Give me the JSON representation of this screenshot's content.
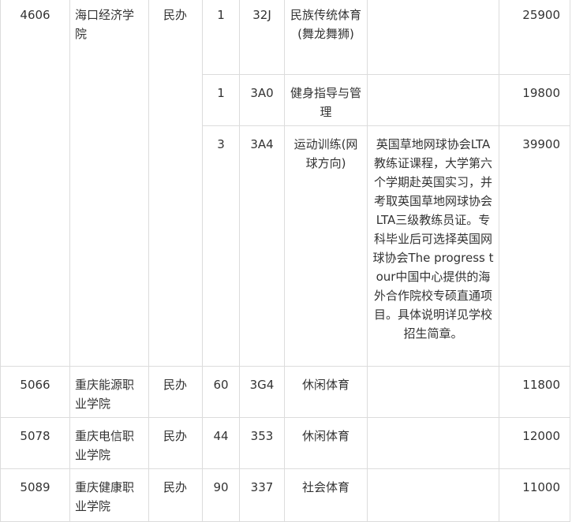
{
  "rows": [
    {
      "code": "4606",
      "school": "海口经济学院",
      "type": "民办",
      "plan": "1",
      "major_code": "32J",
      "major": "民族传统体育(舞龙舞狮)",
      "note": "",
      "fee": "25900"
    },
    {
      "plan": "1",
      "major_code": "3A0",
      "major": "健身指导与管理",
      "note": "",
      "fee": "19800"
    },
    {
      "plan": "3",
      "major_code": "3A4",
      "major": "运动训练(网球方向)",
      "note": "英国草地网球协会LTA教练证课程，大学第六个学期赴英国实习，并考取英国草地网球协会LTA三级教练员证。专科毕业后可选择英国网球协会The progress tour中国中心提供的海外合作院校专硕直通项目。具体说明详见学校招生简章。",
      "fee": "39900"
    },
    {
      "code": "5066",
      "school": "重庆能源职业学院",
      "type": "民办",
      "plan": "60",
      "major_code": "3G4",
      "major": "休闲体育",
      "note": "",
      "fee": "11800"
    },
    {
      "code": "5078",
      "school": "重庆电信职业学院",
      "type": "民办",
      "plan": "44",
      "major_code": "353",
      "major": "休闲体育",
      "note": "",
      "fee": "12000"
    },
    {
      "code": "5089",
      "school": "重庆健康职业学院",
      "type": "民办",
      "plan": "90",
      "major_code": "337",
      "major": "社会体育",
      "note": "",
      "fee": "11000"
    }
  ]
}
